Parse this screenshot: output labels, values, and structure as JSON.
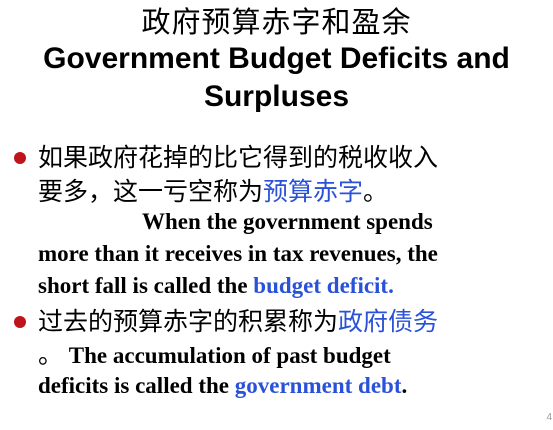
{
  "slide": {
    "title_cn": "政府预算赤字和盈余",
    "title_en_line1": "Government Budget Deficits and",
    "title_en_line2": "Surpluses",
    "point1": {
      "cn_line1": "如果政府花掉的比它得到的税收收入",
      "cn_line2_pre": "要多，这一亏空称为",
      "cn_line2_term": "预算赤字",
      "cn_line2_post": "。",
      "en_line1": "When the government spends",
      "en_line2": "more than it receives in tax revenues, the",
      "en_line3_pre": "short fall is called the ",
      "en_line3_term": "budget deficit."
    },
    "point2": {
      "cn_line1_pre": "过去的预算赤字的积累称为",
      "cn_line1_term": "政府债务",
      "cn_line2_mark": "。",
      "en_line1": " The accumulation of past budget",
      "en_line2_pre": "deficits is called the ",
      "en_line2_term": "government debt",
      "en_line2_post": "."
    },
    "page_number": "4"
  },
  "colors": {
    "bullet": "#c0141c",
    "highlight": "#2a52d8",
    "text": "#000000",
    "background": "#ffffff"
  }
}
